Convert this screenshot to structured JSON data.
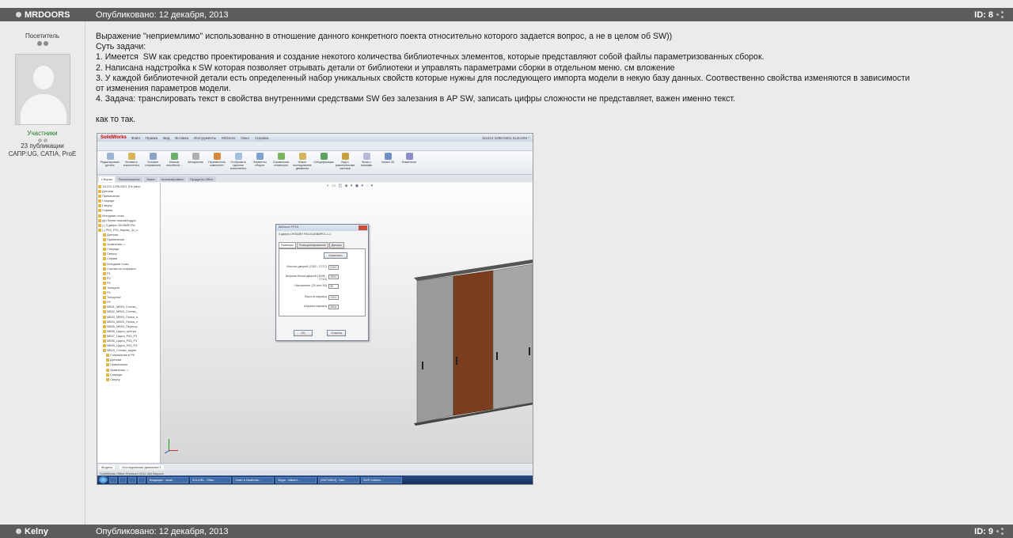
{
  "post1": {
    "author": "MRDOORS",
    "date": "Опубликовано: 12 декабря, 2013",
    "id": "ID: 8",
    "sidebar": {
      "group": "Посетитель",
      "role": "Участники",
      "posts": "23 публикации",
      "cad": "САПР:UG, CATIA, ProE"
    },
    "body_lines": [
      "Выражение \"неприемлимо\" использованно в отношение данного конкретного поекта относительно которого задается вопрос, а не в целом об SW))",
      "Суть задачи:",
      "1. Имеется  SW как средство проектирования и создание некотого количества библиотечных элементов, которые представляют собой файлы параметризованных сборок.",
      "2. Написана надстройка к SW которая позволяет отрывать детали от библиотеки и управлять параметрами сборки в отдельном меню. см вложение",
      "3. У каждой библиотечной детали есть определенный набор уникальных свойств которые нужны для последующего импорта модели в некую базу данных. Соотвественно свойства изменяются в зависимости",
      "от изменения параметров модели.",
      "4. Задача: транслировать текст в свойства внутренними средствами SW без залезания в AP SW, записать цифры сложности не представляет, важен именно текст."
    ],
    "closing": "как то так."
  },
  "post2": {
    "author": "Kelny",
    "date": "Опубликовано: 12 декабря, 2013",
    "id": "ID: 9"
  },
  "attachment": {
    "app_logo": "SolidWorks",
    "window_title": "111212-1296-0401.SLDASM *",
    "menu": [
      "Файл",
      "Правка",
      "Вид",
      "Вставка",
      "Инструменты",
      "MrDoors",
      "Окно",
      "Справка"
    ],
    "ribbon": [
      "Редактировать деталь",
      "Вставить компоненты",
      "Условие сопряжения",
      "Массив линейный...",
      "Автокрепеж",
      "Переместить компонент",
      "Отобразить скрытые компоненты",
      "Элементы сборки",
      "Справочная геометрия",
      "Новое исследование движения",
      "Спецификация",
      "Вид с разнесенными частями",
      "Эскиз с линиями",
      "Instant 3D",
      "Изменение"
    ],
    "tabs": [
      "Сборка",
      "Расположение",
      "Эскиз",
      "Анализировать",
      "Продукты Office"
    ],
    "tree": [
      "111212-1296-0401 (По умол",
      "Датчики",
      "Примечания",
      "Спереди",
      "Сверху",
      "Справа",
      "Исходная точка",
      "(ф) Линии эскиза/Кадры",
      "(-) 3 двери ОНЛАЙН РА",
      "(-) Р63_Р33_Каркас_3с_с",
      "Датчики",
      "Примечания",
      "Уравнения ->",
      "Спереди",
      "Сверху",
      "Справа",
      "Исходная точка",
      "Ссылка на сопряжен",
      "P1",
      "P2",
      "P3",
      "Толщина",
      "P4",
      "Толщина2",
      "P5",
      "МВ01_МВ03_Стенка_",
      "МВ02_МВ03_Стенка_",
      "МВ03_МВ03_Полка_л",
      "МВ04_МВ03_Полка_о",
      "МВ05_МВ03_Перегор",
      "МВ06_Царга_центра",
      "МВ07_Царга_Р63_Р3",
      "МВ08_Царга_Р63_Р3",
      "МВ09_Царга_Р63_Р3",
      "МВ10_Стенка_задни",
      "Сопряжения в Р6",
      "Датчики",
      "Примечания",
      "Уравнения ->",
      "Спереди",
      "Сверху"
    ],
    "dialog": {
      "title": "MrDoors FFSS",
      "subtitle": "3 двери ОНЛАЙН РА1041ЕВВР01-1-1",
      "tabs": [
        "Размеры",
        "Позиционирование",
        "Декоры"
      ],
      "change_btn": "Изменить",
      "rows": [
        {
          "label": "Высота дверей (1302 - 2717)",
          "value": "2400"
        },
        {
          "label": "Ширина блока дверей (1696 - 2743)",
          "value": "2600"
        },
        {
          "label": "Наложение (20 или 30)",
          "value": "30"
        },
        {
          "label": "Высота каркаса",
          "value": "2402"
        },
        {
          "label": "Ширина каркаса",
          "value": "2604"
        }
      ],
      "ok": "OK",
      "cancel": "Отмена"
    },
    "bottom_tabs": [
      "Модель",
      "Исследование движения 1"
    ],
    "status": "SolidWorks Office Premium 2011 x64 Версия",
    "taskbar": [
      "Входящие - small...",
      "SOLIDW... Office...",
      "Ответ в Свойства...",
      "Skype - wilson1...",
      "[200719610] - Окн...",
      "SWS Solution..."
    ]
  },
  "colors": {
    "header_bg": "#5c5c5c",
    "page_bg": "#ebebeb",
    "role_green": "#1e7a1e",
    "door_gray": "#9a9a98",
    "door_wood": "#7a3e1e"
  }
}
